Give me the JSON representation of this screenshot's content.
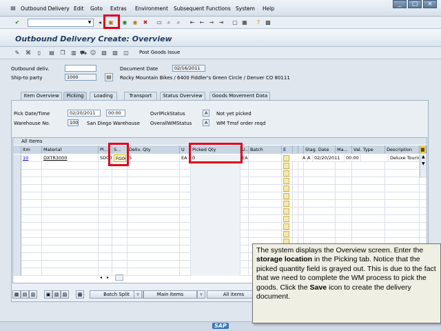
{
  "menu": {
    "items": [
      "Outbound Delivery",
      "Edit",
      "Goto",
      "Extras",
      "Environment",
      "Subsequent Functions",
      "System",
      "Help"
    ]
  },
  "window_buttons": [
    "_",
    "□",
    "×"
  ],
  "title": "Outbound Delivery  Create: Overview",
  "toolbar2": {
    "post_goods_issue": "Post Goods Issue"
  },
  "header": {
    "outbound_deliv_label": "Outbound deliv.",
    "outbound_deliv_value": "",
    "document_date_label": "Document Date",
    "document_date_value": "02/16/2011",
    "ship_to_label": "Ship-to party",
    "ship_to_value": "1000",
    "ship_to_text": "Rocky Mountain Bikes / 6400 Fiddler's Green Circle / Denver CO 80111"
  },
  "tabs": [
    {
      "label": "Item Overview",
      "active": false
    },
    {
      "label": "Picking",
      "active": true
    },
    {
      "label": "Loading",
      "active": false
    },
    {
      "label": "Transport",
      "active": false
    },
    {
      "label": "Status Overview",
      "active": false
    },
    {
      "label": "Goods Movement Data",
      "active": false
    }
  ],
  "picking": {
    "pick_date_label": "Pick Date/Time",
    "pick_date_value": "02/20/2011",
    "pick_time_value": "00:00",
    "ovrl_pick_status_label": "OvrlPickStatus",
    "ovrl_pick_status_code": "A",
    "ovrl_pick_status_text": "Not yet picked",
    "warehouse_label": "Warehouse No.",
    "warehouse_value": "100",
    "warehouse_text": "San Diego Warehouse",
    "overall_wm_label": "OverallWMStatus",
    "overall_wm_code": "A",
    "overall_wm_text": "WM Tmsf order reqd"
  },
  "grid": {
    "title": "All Items",
    "headers": [
      "Itm",
      "Material",
      "Pl...",
      "S...",
      "Deliv. Qty",
      "U",
      "Picked Qty",
      "U...",
      "Batch",
      "E",
      "",
      "",
      "Stag. Date",
      "Ma...",
      "Val. Type",
      "Description"
    ],
    "row": {
      "itm": "10",
      "material": "DXTR3000",
      "plant": "SD00",
      "sloc": "FG00",
      "deliv_qty": "5",
      "unit": "EA",
      "picked_qty": "0",
      "unit2": "EA",
      "batch": "",
      "s1": "A",
      "s2": "A",
      "stag_date": "02/20/2011",
      "ma": "00:00",
      "val_type": "",
      "description": "Deluxe Touring..."
    }
  },
  "bottom_buttons": {
    "batch_split": "Batch Split",
    "main_items": "Main items",
    "all_items": "All items"
  },
  "callout": {
    "p1": "The system displays the Overview screen. Enter the ",
    "b1": "storage location",
    "p2": " in the Picking tab. Notice that the picked quantity field is grayed out. This is due to the fact that we need to complete the WM process to pick the goods. Click the ",
    "b2": "Save",
    "p3": " icon to create the delivery document."
  },
  "footer": {
    "logo": "SAP"
  },
  "colors": {
    "highlight": "#e0001a",
    "title": "#1f3b5c"
  }
}
